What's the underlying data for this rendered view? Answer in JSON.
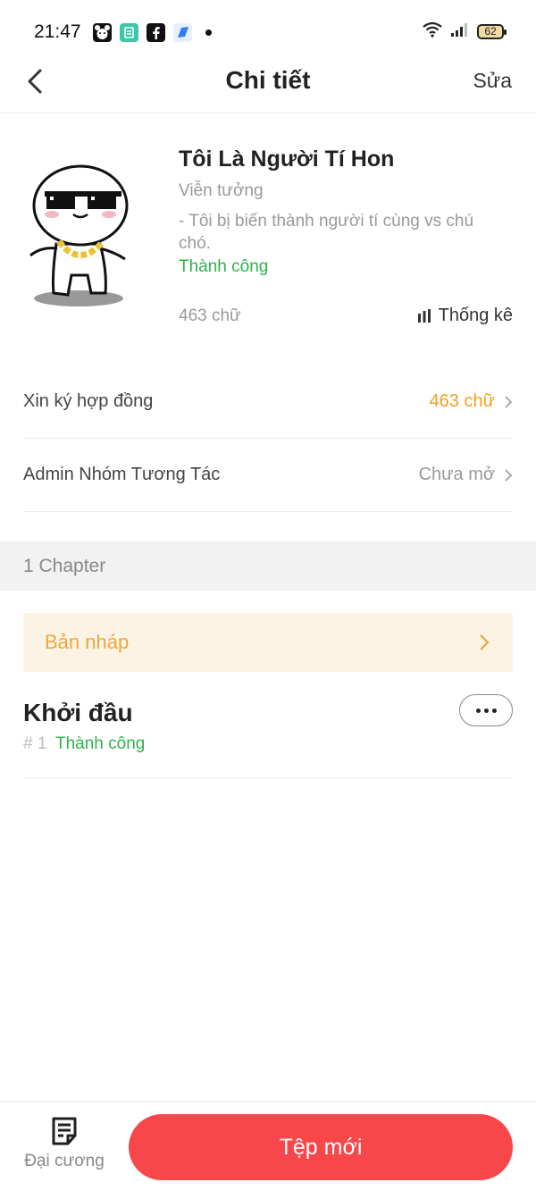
{
  "status_bar": {
    "time": "21:47",
    "battery": "62",
    "icons": [
      "bear-app-icon",
      "teal-app-icon",
      "facebook-icon",
      "blue-app-icon",
      "wifi-icon",
      "signal-icon",
      "battery-icon"
    ]
  },
  "header": {
    "title": "Chi tiết",
    "edit_label": "Sửa"
  },
  "book": {
    "title": "Tôi Là Người Tí Hon",
    "genre": "Viễn tưởng",
    "description": "- Tôi bị biến thành người tí cùng vs chú chó.",
    "status": "Thành công",
    "word_count": "463 chữ",
    "stats_label": "Thống kê"
  },
  "rows": [
    {
      "label": "Xin ký hợp đồng",
      "value": "463 chữ"
    },
    {
      "label": "Admin Nhóm Tương Tác",
      "value": "Chưa mở"
    }
  ],
  "chapters_header": "1 Chapter",
  "draft_label": "Bản nháp",
  "chapter": {
    "title": "Khởi đầu",
    "number": "# 1",
    "status": "Thành công"
  },
  "bottom": {
    "outline_label": "Đại cương",
    "new_file_label": "Tệp mới"
  },
  "colors": {
    "accent_red": "#f7474a",
    "success_green": "#2db34a",
    "warning_orange": "#f0a020",
    "draft_bg": "#fdf3e5"
  }
}
